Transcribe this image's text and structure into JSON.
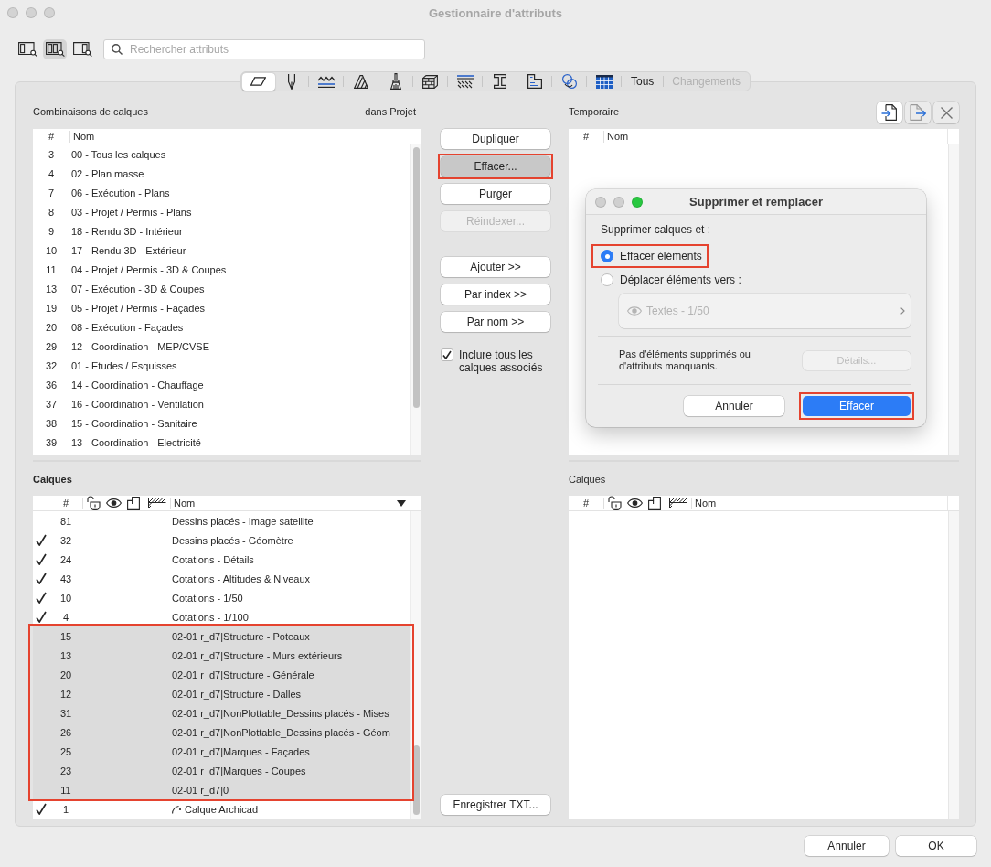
{
  "window": {
    "title": "Gestionnaire d'attributs",
    "active": false
  },
  "toolbar": {
    "view_buttons": [
      {
        "selected": false
      },
      {
        "selected": true
      },
      {
        "selected": false
      }
    ],
    "search": {
      "placeholder": "Rechercher attributs"
    }
  },
  "attribute_tabs": [
    {
      "kind": "icon",
      "selected": true
    },
    {
      "kind": "icon",
      "selected": false
    },
    {
      "kind": "icon",
      "selected": false
    },
    {
      "kind": "icon",
      "selected": false
    },
    {
      "kind": "icon",
      "selected": false
    },
    {
      "kind": "icon",
      "selected": false
    },
    {
      "kind": "icon",
      "selected": false
    },
    {
      "kind": "icon",
      "selected": false
    },
    {
      "kind": "icon",
      "selected": false
    },
    {
      "kind": "icon",
      "selected": false
    },
    {
      "kind": "icon",
      "selected": false
    },
    {
      "kind": "text",
      "label": "Tous",
      "selected": false,
      "disabled": false
    },
    {
      "kind": "text",
      "label": "Changements",
      "selected": false,
      "disabled": true
    }
  ],
  "left": {
    "combinations": {
      "title": "Combinaisons de calques",
      "focused": false,
      "scope": "dans Projet",
      "columns": {
        "number": "#",
        "name": "Nom"
      },
      "rows": [
        {
          "index": "3",
          "name": "00 - Tous les calques"
        },
        {
          "index": "4",
          "name": "02 - Plan masse"
        },
        {
          "index": "7",
          "name": "06 - Exécution - Plans"
        },
        {
          "index": "8",
          "name": "03 - Projet / Permis - Plans"
        },
        {
          "index": "9",
          "name": "18 - Rendu 3D - Intérieur"
        },
        {
          "index": "10",
          "name": "17 - Rendu 3D - Extérieur"
        },
        {
          "index": "11",
          "name": "04 - Projet / Permis - 3D & Coupes"
        },
        {
          "index": "13",
          "name": "07 - Exécution - 3D & Coupes"
        },
        {
          "index": "19",
          "name": "05 - Projet / Permis - Façades"
        },
        {
          "index": "20",
          "name": "08 - Exécution - Façades"
        },
        {
          "index": "29",
          "name": "12 - Coordination - MEP/CVSE"
        },
        {
          "index": "32",
          "name": "01 - Etudes / Esquisses"
        },
        {
          "index": "36",
          "name": "14 - Coordination - Chauffage"
        },
        {
          "index": "37",
          "name": "16 - Coordination - Ventilation"
        },
        {
          "index": "38",
          "name": "15 - Coordination - Sanitaire"
        },
        {
          "index": "39",
          "name": "13 - Coordination - Electricité"
        }
      ]
    },
    "layers": {
      "title": "Calques",
      "focused": true,
      "columns": {
        "number": "#",
        "name": "Nom"
      },
      "name_sorted": true,
      "selection_annotated": true,
      "rows": [
        {
          "kind": "layer",
          "index": "81",
          "name": "Dessins placés - Image satellite",
          "checked": false,
          "selected": false
        },
        {
          "kind": "layer",
          "index": "32",
          "name": "Dessins placés - Géomètre",
          "checked": true,
          "selected": false
        },
        {
          "kind": "layer",
          "index": "24",
          "name": "Cotations - Détails",
          "checked": true,
          "selected": false
        },
        {
          "kind": "layer",
          "index": "43",
          "name": "Cotations - Altitudes & Niveaux",
          "checked": true,
          "selected": false
        },
        {
          "kind": "layer",
          "index": "10",
          "name": "Cotations - 1/50",
          "checked": true,
          "selected": false
        },
        {
          "kind": "layer",
          "index": "4",
          "name": "Cotations - 1/100",
          "checked": true,
          "selected": false
        },
        {
          "kind": "layer",
          "index": "15",
          "name": "02-01 r_d7|Structure - Poteaux",
          "checked": false,
          "selected": true
        },
        {
          "kind": "layer",
          "index": "13",
          "name": "02-01 r_d7|Structure - Murs extérieurs",
          "checked": false,
          "selected": true
        },
        {
          "kind": "layer",
          "index": "20",
          "name": "02-01 r_d7|Structure - Générale",
          "checked": false,
          "selected": true
        },
        {
          "kind": "layer",
          "index": "12",
          "name": "02-01 r_d7|Structure - Dalles",
          "checked": false,
          "selected": true
        },
        {
          "kind": "layer",
          "index": "31",
          "name": "02-01 r_d7|NonPlottable_Dessins placés - Mises",
          "checked": false,
          "selected": true
        },
        {
          "kind": "layer",
          "index": "26",
          "name": "02-01 r_d7|NonPlottable_Dessins placés - Géom",
          "checked": false,
          "selected": true
        },
        {
          "kind": "layer",
          "index": "25",
          "name": "02-01 r_d7|Marques - Façades",
          "checked": false,
          "selected": true
        },
        {
          "kind": "layer",
          "index": "23",
          "name": "02-01 r_d7|Marques - Coupes",
          "checked": false,
          "selected": true
        },
        {
          "kind": "layer",
          "index": "11",
          "name": "02-01 r_d7|0",
          "checked": false,
          "selected": true
        },
        {
          "kind": "archicad",
          "index": "1",
          "name": "Calque Archicad",
          "checked": true,
          "selected": false
        }
      ]
    }
  },
  "actions": {
    "buttons": [
      {
        "label": "Dupliquer",
        "pressed": false,
        "disabled": false,
        "annotated": false
      },
      {
        "label": "Effacer...",
        "pressed": true,
        "disabled": false,
        "annotated": true
      },
      {
        "label": "Purger",
        "pressed": false,
        "disabled": false,
        "annotated": false
      },
      {
        "label": "Réindexer...",
        "pressed": false,
        "disabled": true,
        "annotated": false
      }
    ],
    "add_buttons": [
      "Ajouter >>",
      "Par index >>",
      "Par nom >>"
    ],
    "include_associated": {
      "label": "Inclure tous les calques associés",
      "checked": true
    },
    "save_button": "Enregistrer TXT..."
  },
  "right": {
    "temporary": {
      "title": "Temporaire",
      "focused": false,
      "header_buttons": [
        {
          "disabled": false
        },
        {
          "disabled": true
        },
        {
          "disabled": true
        }
      ],
      "columns": {
        "number": "#",
        "name": "Nom"
      }
    },
    "layers": {
      "title": "Calques",
      "focused": false,
      "columns": {
        "number": "#",
        "name": "Nom"
      }
    }
  },
  "dialog": {
    "title": "Supprimer et remplacer",
    "window_controls": [
      {
        "disabled": true
      },
      {
        "disabled": true
      },
      {
        "disabled": false
      }
    ],
    "prompt": "Supprimer calques et :",
    "options": [
      {
        "label": "Effacer éléments",
        "selected": true,
        "annotated": true
      },
      {
        "label": "Déplacer éléments vers :",
        "selected": false,
        "annotated": false
      }
    ],
    "target": {
      "value": "Textes - 1/50",
      "disabled": true
    },
    "message": "Pas d'éléments supprimés ou d'attributs manquants.",
    "details_button": {
      "label": "Détails...",
      "disabled": true
    },
    "buttons": [
      {
        "label": "Annuler",
        "primary": false,
        "annotated": false
      },
      {
        "label": "Effacer",
        "primary": true,
        "annotated": true
      }
    ]
  },
  "footer": {
    "buttons": [
      "Annuler",
      "OK"
    ]
  }
}
